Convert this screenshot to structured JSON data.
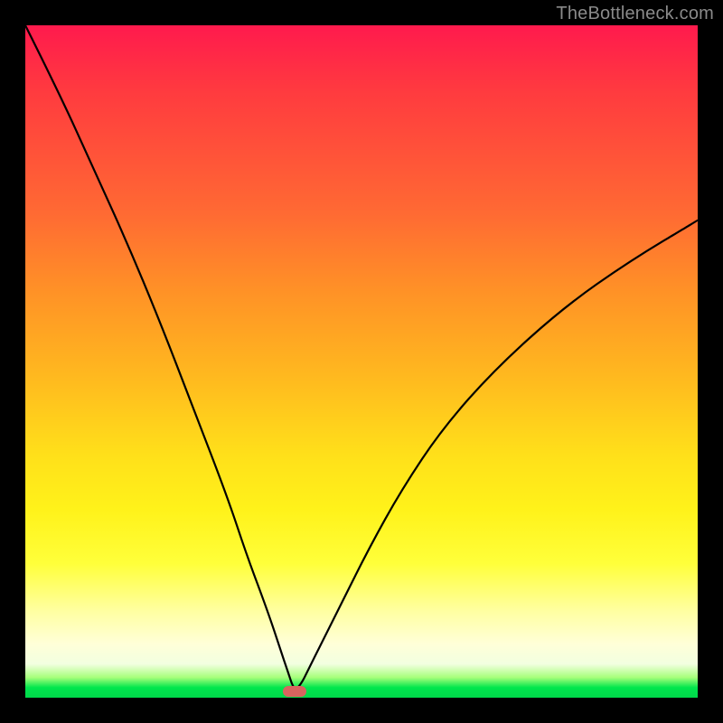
{
  "watermark": {
    "text": "TheBottleneck.com"
  },
  "chart_data": {
    "type": "line",
    "title": "",
    "xlabel": "",
    "ylabel": "",
    "xlim": [
      0,
      100
    ],
    "ylim": [
      0,
      100
    ],
    "grid": false,
    "legend": false,
    "series": [
      {
        "name": "curve",
        "x": [
          0,
          5,
          10,
          15,
          20,
          25,
          30,
          33,
          36,
          38,
          39,
          40,
          41,
          42,
          44,
          47,
          51,
          56,
          62,
          70,
          80,
          90,
          100
        ],
        "y": [
          100,
          90,
          79,
          68,
          56,
          43,
          30,
          21,
          13,
          7,
          4,
          1,
          2,
          4,
          8,
          14,
          22,
          31,
          40,
          49,
          58,
          65,
          71
        ]
      }
    ],
    "minimum": {
      "x": 40,
      "y": 1,
      "width_pct": 3.5
    },
    "gradient_stops": [
      {
        "pct": 0,
        "color": "#ff1a4d"
      },
      {
        "pct": 28,
        "color": "#ff6a33"
      },
      {
        "pct": 64,
        "color": "#ffe01a"
      },
      {
        "pct": 92,
        "color": "#ffffd8"
      },
      {
        "pct": 100,
        "color": "#00d84a"
      }
    ],
    "marker_color": "#d9645f"
  }
}
